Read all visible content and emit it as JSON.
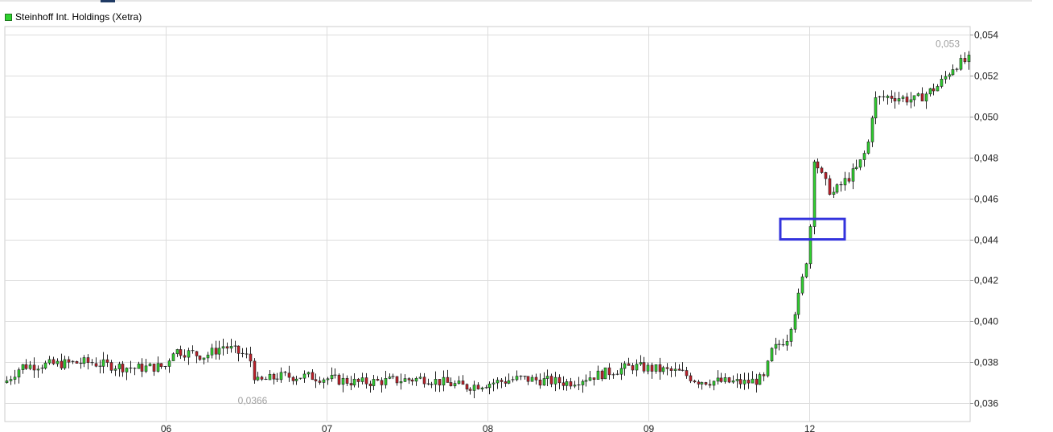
{
  "chart_data": {
    "type": "candlestick",
    "series_name": "Steinhoff Int. Holdings (Xetra)",
    "x_ticks": [
      "06",
      "07",
      "08",
      "09",
      "12"
    ],
    "y_ticks": [
      "0,054",
      "0,052",
      "0,050",
      "0,048",
      "0,046",
      "0,044",
      "0,042",
      "0,040",
      "0,038",
      "0,036"
    ],
    "y_tick_values": [
      0.054,
      0.052,
      0.05,
      0.048,
      0.046,
      0.044,
      0.042,
      0.04,
      0.038,
      0.036
    ],
    "ylim": [
      0.0351,
      0.0544
    ],
    "x_range": [
      0,
      300
    ],
    "x_tick_positions": [
      50,
      100,
      150,
      200,
      250
    ],
    "grid": true,
    "annotations": [
      {
        "label": "0,0366",
        "x": 77,
        "y": 0.0366,
        "kind": "min"
      },
      {
        "label": "0,053",
        "x": 293,
        "y": 0.053,
        "kind": "max"
      }
    ],
    "highlight_box": {
      "x0": 241,
      "x1": 261,
      "y0": 0.044,
      "y1": 0.045,
      "color": "#3333dd"
    },
    "colors": {
      "up": "#2fd12f",
      "down": "#c0202a",
      "grid": "#dcdcdc",
      "axis": "#cccccc"
    }
  }
}
